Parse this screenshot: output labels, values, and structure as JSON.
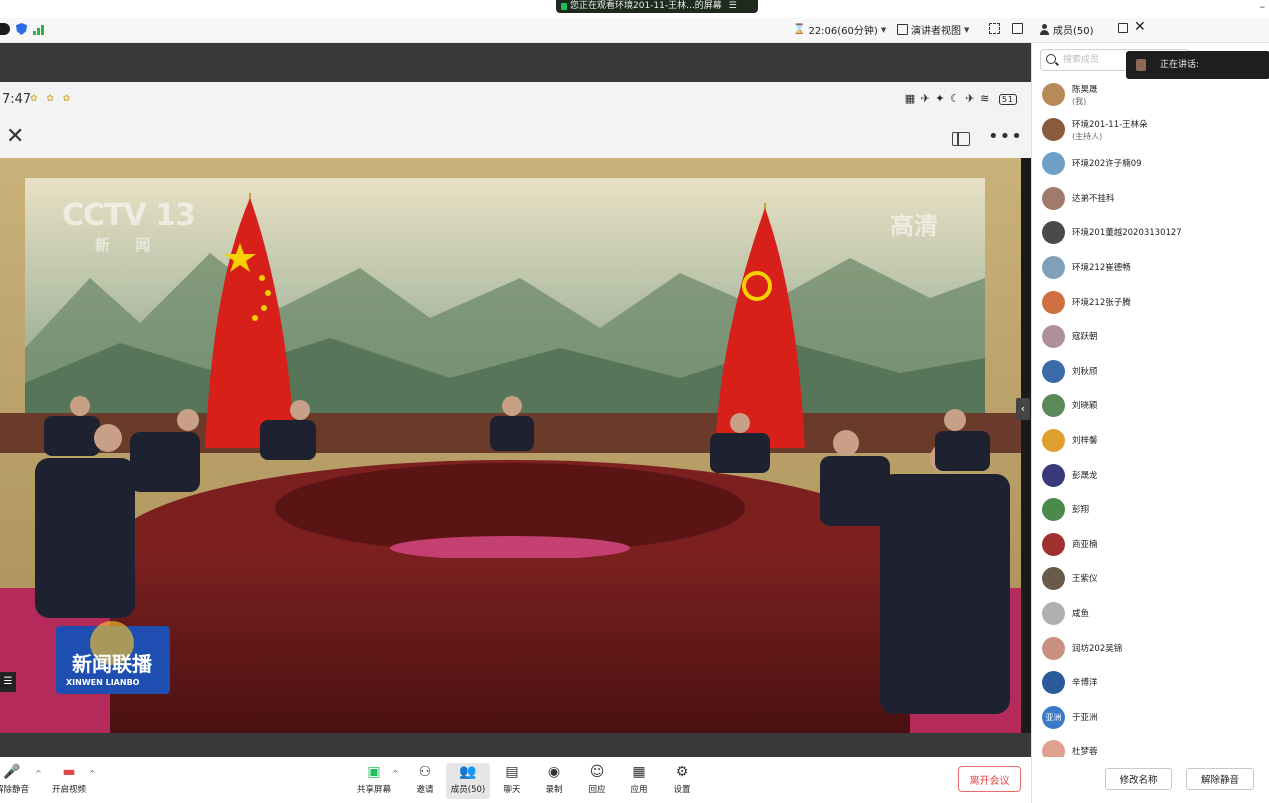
{
  "share_banner": {
    "text": "您正在观看环境201-11-王林...的屏幕",
    "menu_glyph": "☰",
    "indicator_color": "#21c05a"
  },
  "toolbar": {
    "timer": "22:06(60分钟)",
    "view_mode": "演讲者视图",
    "participants": "成员(50)",
    "minimize_glyph": "–"
  },
  "phone": {
    "time": "7:47",
    "status_icons": "▦ ✈ ✦ ☾ ✈ ≋",
    "battery": "51",
    "close_glyph": "✕",
    "more_glyph": "•••"
  },
  "video": {
    "channel_logo": "CCTV 13",
    "channel_sub": "新 闻",
    "hd_badge": "高清",
    "program_title": "新闻联播",
    "program_sub": "XINWEN LIANBO",
    "side_glyph": "☰"
  },
  "panel": {
    "search_placeholder": "搜索成员",
    "speaking_label": "正在讲话:",
    "participants": [
      {
        "name": "陈昊晟",
        "role": "(我)",
        "color": "#b88a5a"
      },
      {
        "name": "环境201-11-王林朵",
        "role": "(主持人)",
        "color": "#8a5a3c"
      },
      {
        "name": "环境202许子楠09",
        "role": "",
        "color": "#6fa0c8"
      },
      {
        "name": "达弟不挂科",
        "role": "",
        "color": "#a07a6a"
      },
      {
        "name": "环境201董越20203130127",
        "role": "",
        "color": "#4a4a4a"
      },
      {
        "name": "环境212崔德畅",
        "role": "",
        "color": "#7fa0b8"
      },
      {
        "name": "环境212张子腾",
        "role": "",
        "color": "#d07040"
      },
      {
        "name": "寇跃朝",
        "role": "",
        "color": "#b09098"
      },
      {
        "name": "刘秋颀",
        "role": "",
        "color": "#3a6aa8"
      },
      {
        "name": "刘晓颖",
        "role": "",
        "color": "#5a8a5a"
      },
      {
        "name": "刘梓馨",
        "role": "",
        "color": "#e0a030"
      },
      {
        "name": "彭晟龙",
        "role": "",
        "color": "#3a3a7a"
      },
      {
        "name": "彭翔",
        "role": "",
        "color": "#4a8a4a"
      },
      {
        "name": "商亚楠",
        "role": "",
        "color": "#a03030"
      },
      {
        "name": "王紫仪",
        "role": "",
        "color": "#6a5a4a"
      },
      {
        "name": "咸鱼",
        "role": "",
        "color": "#b0b0b0"
      },
      {
        "name": "润坊202吴锦",
        "role": "",
        "color": "#c89080"
      },
      {
        "name": "辛博洋",
        "role": "",
        "color": "#2a5a9a"
      },
      {
        "name": "于亚洲",
        "role": "",
        "avatar_text": "亚洲",
        "color": "#3a7ac8"
      },
      {
        "name": "杜梦蓉",
        "role": "",
        "color": "#e0a090"
      }
    ],
    "rename_button": "修改名称",
    "unmute_all_button": "解除静音"
  },
  "bottom_bar": {
    "unmute": "解除静音",
    "start_video": "开启视频",
    "share_screen": "共享屏幕",
    "invite": "邀请",
    "participants": "成员(50)",
    "chat": "聊天",
    "record": "录制",
    "reactions": "回应",
    "apps": "应用",
    "settings": "设置",
    "leave": "离开会议",
    "up_caret": "^",
    "glyphs": {
      "unmute": "🎤",
      "video": "▬",
      "share": "▣",
      "invite": "⚇",
      "participants": "👥",
      "chat": "▤",
      "record": "◉",
      "reactions": "☺",
      "apps": "▦",
      "settings": "⚙"
    }
  },
  "colors": {
    "accent_red": "#e04848",
    "share_green": "#21c05a",
    "shield_blue": "#2e6ce6"
  }
}
